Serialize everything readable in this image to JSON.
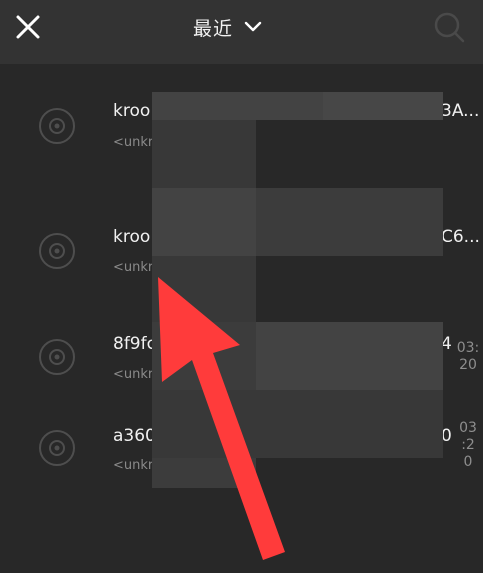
{
  "header": {
    "title": "最近",
    "close_icon": "close-icon",
    "dropdown_icon": "chevron-down-icon",
    "search_icon": "search-icon"
  },
  "list": {
    "items": [
      {
        "title": "kroo",
        "tail": "3A...",
        "subtitle": "<unkr",
        "duration": ""
      },
      {
        "title": "kroo",
        "tail": "C6...",
        "subtitle": "<unkr",
        "duration": ""
      },
      {
        "title": "8f9fc",
        "tail": "4",
        "subtitle": "<unkr",
        "duration_lines": [
          "03:",
          "20"
        ]
      },
      {
        "title": "a360",
        "tail": "0",
        "subtitle": "<unkr",
        "duration_lines": [
          "03",
          ":2",
          "0"
        ]
      }
    ]
  },
  "colors": {
    "header_bg": "#333333",
    "list_bg": "#282828",
    "arrow": "#ff3b3b"
  }
}
